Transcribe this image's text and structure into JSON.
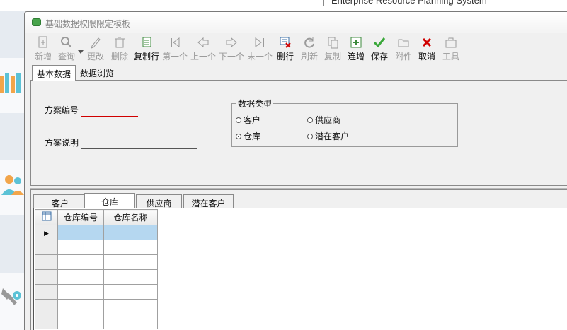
{
  "background": {
    "tagline": "Enterprise Resource Planning System"
  },
  "window": {
    "title": "基础数据权限限定模板"
  },
  "toolbar": {
    "buttons": [
      {
        "label": "新增",
        "icon": "new-doc-icon",
        "enabled": false
      },
      {
        "label": "查询",
        "icon": "search-icon",
        "enabled": false
      },
      {
        "label": "更改",
        "icon": "pencil-icon",
        "enabled": false
      },
      {
        "label": "删除",
        "icon": "trash-icon",
        "enabled": false
      },
      {
        "label": "复制行",
        "icon": "copy-row-icon",
        "enabled": true
      },
      {
        "label": "第一个",
        "icon": "first-record-icon",
        "enabled": false
      },
      {
        "label": "上一个",
        "icon": "arrow-left-icon",
        "enabled": false
      },
      {
        "label": "下一个",
        "icon": "arrow-right-icon",
        "enabled": false
      },
      {
        "label": "末一个",
        "icon": "last-record-icon",
        "enabled": false
      },
      {
        "label": "删行",
        "icon": "delete-row-icon",
        "enabled": true
      },
      {
        "label": "刷新",
        "icon": "refresh-icon",
        "enabled": false
      },
      {
        "label": "复制",
        "icon": "copy-icon",
        "enabled": false
      },
      {
        "label": "连增",
        "icon": "continuous-add-icon",
        "enabled": true
      },
      {
        "label": "保存",
        "icon": "checkmark-icon",
        "enabled": true
      },
      {
        "label": "附件",
        "icon": "folder-icon",
        "enabled": false
      },
      {
        "label": "取消",
        "icon": "cancel-x-icon",
        "enabled": true
      },
      {
        "label": "工具",
        "icon": "toolbox-icon",
        "enabled": false
      }
    ]
  },
  "top_tabs": {
    "basic": "基本数据",
    "browse": "数据浏览"
  },
  "form": {
    "scheme_no_label": "方案编号",
    "scheme_no_value": "",
    "scheme_desc_label": "方案说明",
    "scheme_desc_value": "",
    "data_type_legend": "数据类型",
    "radios": {
      "customer": "客户",
      "supplier": "供应商",
      "warehouse": "仓库",
      "potential": "潜在客户"
    },
    "selected_radio": "仓库",
    "required_color": "#d00000"
  },
  "bottom_tabs": {
    "customer": "客户",
    "warehouse": "仓库",
    "supplier": "供应商",
    "potential": "潜在客户"
  },
  "grid": {
    "headers": {
      "code": "仓库编号",
      "name": "仓库名称"
    },
    "selection_color": "#b5d7f0",
    "current_row_marker": "▶"
  }
}
